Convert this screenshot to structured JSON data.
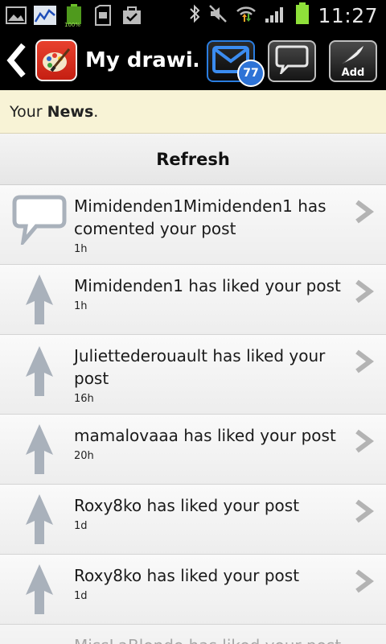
{
  "status_bar": {
    "time": "11:27",
    "battery_label": "100%",
    "icons": [
      "gallery-icon",
      "stocks-icon",
      "battery-widget-icon",
      "sd-card-icon",
      "task-check-icon",
      "bluetooth-icon",
      "mute-icon",
      "wifi-icon",
      "signal-icon",
      "battery-icon"
    ]
  },
  "action_bar": {
    "title": "My drawi…",
    "message_count": "77",
    "add_label": "Add"
  },
  "news": {
    "prefix": "Your ",
    "bold": "News",
    "suffix": "."
  },
  "refresh_label": "Refresh",
  "notifications": [
    {
      "icon": "comment",
      "text": "Mimidenden1Mimidenden1 has comented your post",
      "time": "1h"
    },
    {
      "icon": "like",
      "text": "Mimidenden1 has liked your post",
      "time": "1h"
    },
    {
      "icon": "like",
      "text": "Juliettederouault has liked your post",
      "time": "16h"
    },
    {
      "icon": "like",
      "text": "mamalovaaa has liked your post",
      "time": "20h"
    },
    {
      "icon": "like",
      "text": "Roxy8ko has liked your post",
      "time": "1d"
    },
    {
      "icon": "like",
      "text": "Roxy8ko has liked your post",
      "time": "1d"
    },
    {
      "icon": "like",
      "text": "MissLaBlonde has liked your post",
      "time": ""
    }
  ],
  "colors": {
    "accent": "#2e73d6",
    "banner": "#f8f3d6",
    "icon_grey": "#a9b1bb"
  }
}
